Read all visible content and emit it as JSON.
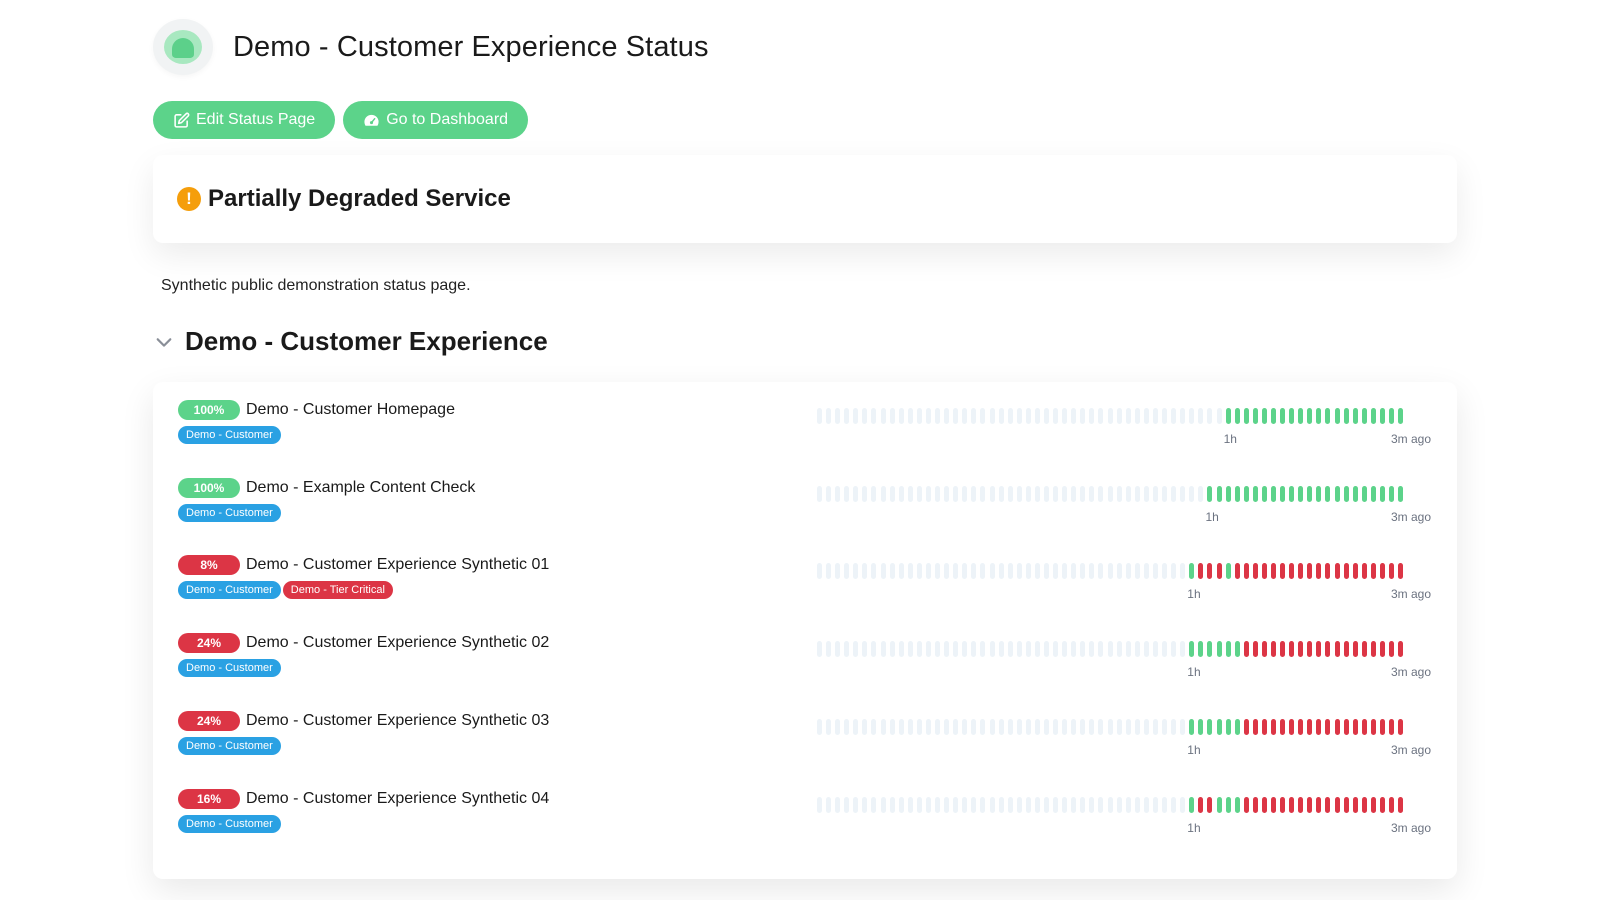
{
  "header": {
    "title": "Demo - Customer Experience Status",
    "logo_icon": "uptime-kuma-logo-icon"
  },
  "toolbar": {
    "edit_label": "Edit Status Page",
    "edit_icon": "edit-icon",
    "dashboard_label": "Go to Dashboard",
    "dashboard_icon": "dashboard-gauge-icon"
  },
  "overall": {
    "status_text": "Partially Degraded Service",
    "icon": "warning-icon",
    "icon_glyph": "!"
  },
  "description": "Synthetic public demonstration status page.",
  "group": {
    "title": "Demo - Customer Experience",
    "expanded": true
  },
  "labels": {
    "start": "1h",
    "end": "3m ago"
  },
  "colors": {
    "up": "#5cd38a",
    "down": "#dc3545",
    "empty": "#edf3f8",
    "tag_blue": "#2aa1e3",
    "tag_red": "#dc3545",
    "warning": "#f59e0b"
  },
  "monitors": [
    {
      "uptime": "100%",
      "state": "up",
      "name": "Demo - Customer Homepage",
      "tags": [
        {
          "label": "Demo - Customer",
          "color": "blue"
        }
      ],
      "beats": "uuuuuuuuuuuuuuuuuuuu"
    },
    {
      "uptime": "100%",
      "state": "up",
      "name": "Demo - Example Content Check",
      "tags": [
        {
          "label": "Demo - Customer",
          "color": "blue"
        }
      ],
      "beats": "uuuuuuuuuuuuuuuuuuuuuu"
    },
    {
      "uptime": "8%",
      "state": "down",
      "name": "Demo - Customer Experience Synthetic 01",
      "tags": [
        {
          "label": "Demo - Customer",
          "color": "blue"
        },
        {
          "label": "Demo - Tier Critical",
          "color": "red"
        }
      ],
      "beats": "uddduddddddddddddddddddd"
    },
    {
      "uptime": "24%",
      "state": "down",
      "name": "Demo - Customer Experience Synthetic 02",
      "tags": [
        {
          "label": "Demo - Customer",
          "color": "blue"
        }
      ],
      "beats": "uuuuuudddddddddddddddddd"
    },
    {
      "uptime": "24%",
      "state": "down",
      "name": "Demo - Customer Experience Synthetic 03",
      "tags": [
        {
          "label": "Demo - Customer",
          "color": "blue"
        }
      ],
      "beats": "uuuuuudddddddddddddddddd"
    },
    {
      "uptime": "16%",
      "state": "down",
      "name": "Demo - Customer Experience Synthetic 04",
      "tags": [
        {
          "label": "Demo - Customer",
          "color": "blue"
        }
      ],
      "beats": "udduuudddddddddddddddddd"
    }
  ]
}
